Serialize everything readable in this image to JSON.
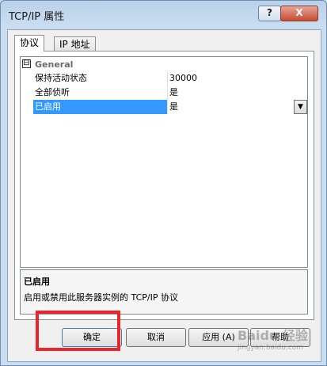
{
  "window": {
    "title": "TCP/IP 属性",
    "help_label": "?",
    "close_label": "X"
  },
  "tabs": [
    {
      "label": "协议",
      "active": true
    },
    {
      "label": "IP 地址",
      "active": false
    }
  ],
  "property_grid": {
    "category": {
      "label": "General",
      "toggle": "⊟"
    },
    "rows": [
      {
        "name": "保持活动状态",
        "value": "30000",
        "selected": false
      },
      {
        "name": "全部侦听",
        "value": "是",
        "selected": false
      },
      {
        "name": "已启用",
        "value": "是",
        "selected": true
      }
    ],
    "dropdown_glyph": "▼"
  },
  "description": {
    "title": "已启用",
    "text": "启用或禁用此服务器实例的 TCP/IP 协议"
  },
  "buttons": {
    "ok": "确定",
    "cancel": "取消",
    "apply": "应用 (A)",
    "help": "帮助"
  },
  "watermark": {
    "text": "Baidu 经验",
    "sub": "jingyan.baidu.com"
  },
  "colors": {
    "selection": "#3399ff",
    "highlight_box": "#e8262b"
  }
}
